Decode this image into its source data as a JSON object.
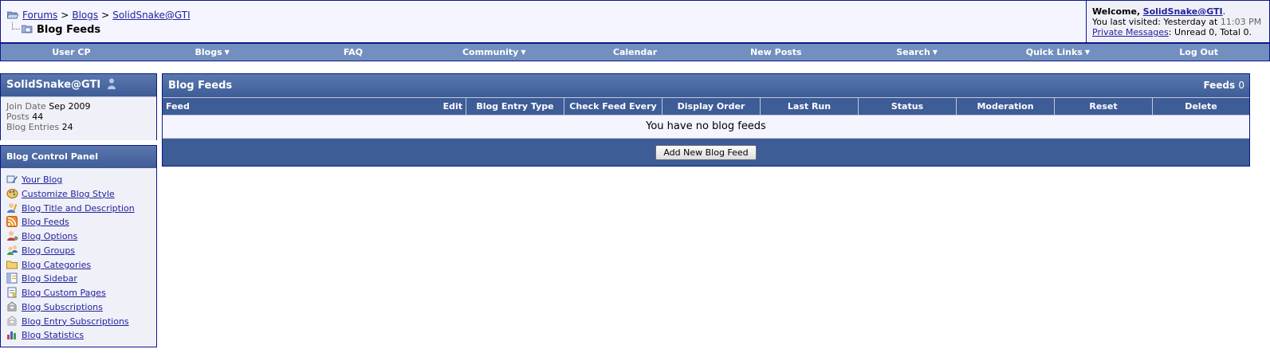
{
  "breadcrumb": {
    "items": [
      "Forums",
      "Blogs",
      "SolidSnake@GTI"
    ],
    "separator": ">",
    "current": "Blog Feeds"
  },
  "welcome": {
    "label": "Welcome,",
    "username": "SolidSnake@GTI",
    "period": ".",
    "last_visited_label": "You last visited: Yesterday at",
    "last_visited_time": "11:03 PM",
    "pm_link": "Private Messages",
    "pm_status": ": Unread 0, Total 0."
  },
  "nav": {
    "items": [
      {
        "label": "User CP",
        "dropdown": false
      },
      {
        "label": "Blogs",
        "dropdown": true
      },
      {
        "label": "FAQ",
        "dropdown": false
      },
      {
        "label": "Community",
        "dropdown": true
      },
      {
        "label": "Calendar",
        "dropdown": false
      },
      {
        "label": "New Posts",
        "dropdown": false
      },
      {
        "label": "Search",
        "dropdown": true
      },
      {
        "label": "Quick Links",
        "dropdown": true
      },
      {
        "label": "Log Out",
        "dropdown": false
      }
    ],
    "arrow": "▼"
  },
  "profile": {
    "username": "SolidSnake@GTI",
    "join_label": "Join Date",
    "join_value": "Sep 2009",
    "posts_label": "Posts",
    "posts_value": "44",
    "entries_label": "Blog Entries",
    "entries_value": "24"
  },
  "control_panel": {
    "title": "Blog Control Panel",
    "links": [
      {
        "label": "Your Blog",
        "icon": "your-blog-icon"
      },
      {
        "label": "Customize Blog Style",
        "icon": "palette-icon"
      },
      {
        "label": "Blog Title and Description",
        "icon": "person-edit-icon"
      },
      {
        "label": "Blog Feeds",
        "icon": "rss-icon"
      },
      {
        "label": "Blog Options",
        "icon": "options-icon"
      },
      {
        "label": "Blog Groups",
        "icon": "group-icon"
      },
      {
        "label": "Blog Categories",
        "icon": "folder-icon"
      },
      {
        "label": "Blog Sidebar",
        "icon": "sidebar-icon"
      },
      {
        "label": "Blog Custom Pages",
        "icon": "page-icon"
      },
      {
        "label": "Blog Subscriptions",
        "icon": "subscription-icon"
      },
      {
        "label": "Blog Entry Subscriptions",
        "icon": "entry-subscription-icon"
      },
      {
        "label": "Blog Statistics",
        "icon": "statistics-icon"
      }
    ]
  },
  "main": {
    "title": "Blog Feeds",
    "feeds_label": "Feeds",
    "feeds_count": "0",
    "columns": {
      "feed": "Feed",
      "edit": "Edit",
      "others": [
        "Blog Entry Type",
        "Check Feed Every",
        "Display Order",
        "Last Run",
        "Status",
        "Moderation",
        "Reset",
        "Delete"
      ]
    },
    "empty_message": "You have no blog feeds",
    "add_button": "Add New Blog Feed"
  },
  "colors": {
    "border": "#0b198c",
    "navbar": "#738fbf",
    "header": "#3e5c96",
    "link": "#22229c",
    "panel_bg": "#f0f0f8"
  }
}
